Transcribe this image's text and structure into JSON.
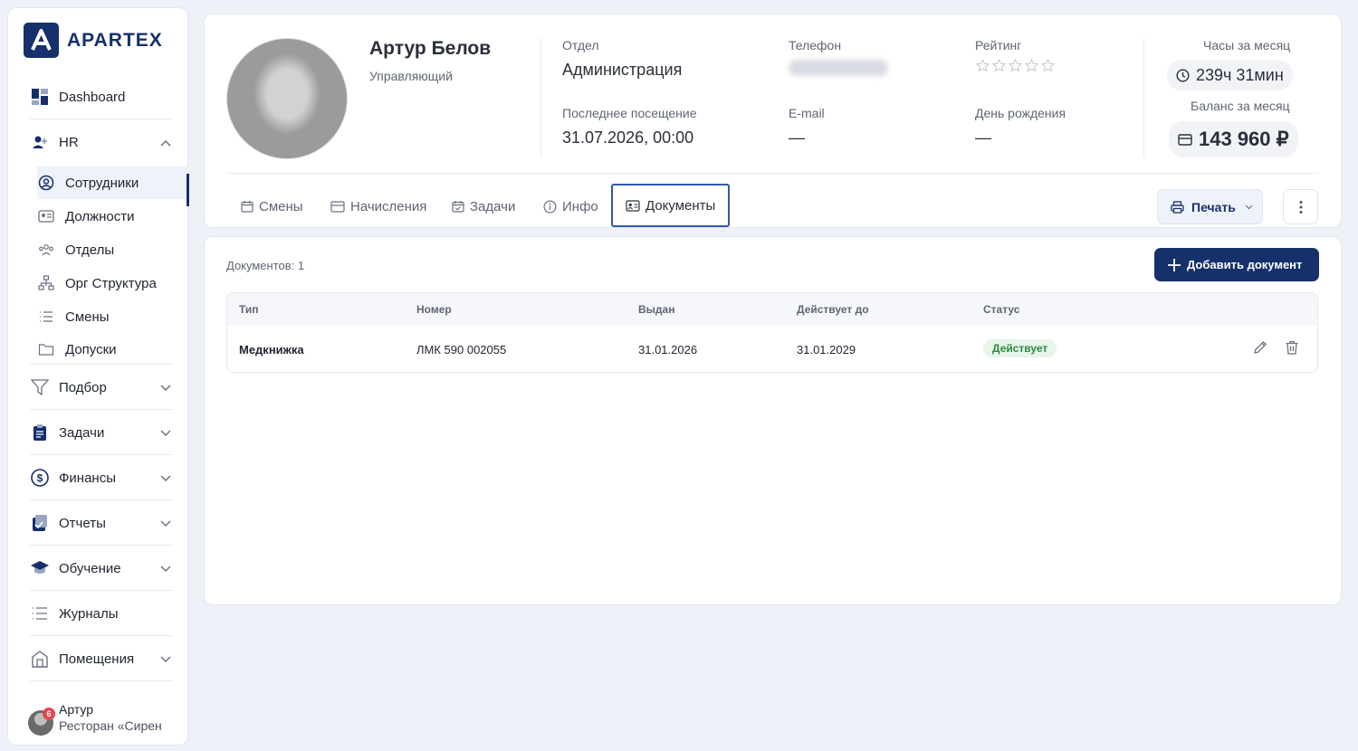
{
  "brand": {
    "name": "APARTEX"
  },
  "sidebar": {
    "dashboard": "Dashboard",
    "hr": "HR",
    "hr_sub": [
      "Сотрудники",
      "Должности",
      "Отделы",
      "Орг Структура",
      "Смены",
      "Допуски"
    ],
    "sections": [
      "Подбор",
      "Задачи",
      "Финансы",
      "Отчеты",
      "Обучение",
      "Журналы",
      "Помещения"
    ],
    "user": {
      "name": "Артур",
      "org": "Ресторан «Сирен",
      "notifications": "6"
    }
  },
  "profile": {
    "name": "Артур Белов",
    "role": "Управляющий",
    "department_label": "Отдел",
    "department": "Администрация",
    "phone_label": "Телефон",
    "rating_label": "Рейтинг",
    "rating": 0,
    "last_visit_label": "Последнее посещение",
    "last_visit": "31.07.2026, 00:00",
    "email_label": "E-mail",
    "email": "—",
    "birthday_label": "День рождения",
    "birthday": "—",
    "hours_label": "Часы за месяц",
    "hours": "239ч 31мин",
    "balance_label": "Баланс за месяц",
    "balance": "143 960 ₽"
  },
  "tabs": [
    "Смены",
    "Начисления",
    "Задачи",
    "Инфо",
    "Документы"
  ],
  "active_tab": "Документы",
  "toolbar": {
    "print": "Печать"
  },
  "documents": {
    "count_label": "Документов: 1",
    "add_label": "Добавить документ",
    "columns": [
      "Тип",
      "Номер",
      "Выдан",
      "Действует до",
      "Статус"
    ],
    "rows": [
      {
        "type": "Медкнижка",
        "number": "ЛМК 590 002055",
        "issued": "31.01.2026",
        "valid_until": "31.01.2029",
        "status": "Действует"
      }
    ]
  },
  "colors": {
    "brand": "#15306b",
    "active_border": "#2d5aa8",
    "status_green": "#2d8a3f",
    "badge_red": "#e5484d"
  }
}
